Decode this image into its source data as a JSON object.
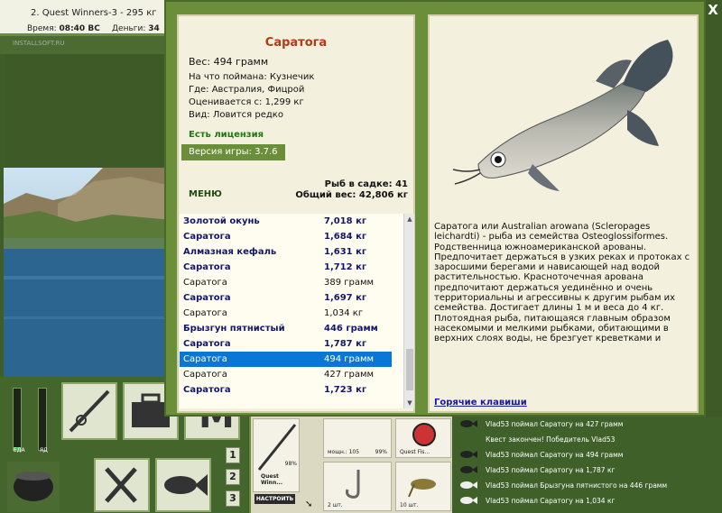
{
  "game_header": {
    "quest_title": "2. Quest Winners-3 - 295 кг",
    "time_label": "Время:",
    "time_value": "08:40 ВС",
    "money_label": "Деньги:",
    "money_value": "34",
    "watermark": "INSTALLSOFT.RU"
  },
  "status_bars": {
    "food_label": "ЕДА",
    "poison_label": "ЯД",
    "food_level": 0.05,
    "poison_level": 0.0
  },
  "tabs": [
    "1",
    "2",
    "3"
  ],
  "tackle": {
    "rod_percent": "98%",
    "rod_name": "Quest Winn...",
    "setup_label": "НАСТРОИТЬ",
    "hook_count": "мощн.: 105",
    "hook_percent": "99%",
    "lure_name": "Quest Fis...",
    "hook_qty": "2 шт.",
    "bait_qty": "10 шт."
  },
  "fish": {
    "name": "Саратога",
    "weight": "Вес: 494 грамм",
    "caught_with": "На что поймана: Кузнечик",
    "location": "Где: Австралия, Фицрой",
    "valued_from": "Оценивается с: 1,299 кг",
    "rarity": "Вид: Ловится редко",
    "license": "Есть лицензия",
    "version": "Версия игры: 3.7.6",
    "menu_label": "МЕНЮ",
    "cage_count": "Рыб в садке: 41",
    "total_weight": "Общий вес: 42,806 кг",
    "description": "Саратога или Australian arowana (Scleropages leichardti) - рыба из семейства Osteoglossiformes. Родственница южноамериканской арованы. Предпочитает держаться в узких реках и протоках с заросшими берегами и нависающей над водой растительностью. Красноточечная арована предпочитают держаться уединённо и очень территориальны и агрессивны к другим рыбам их семейства. Достигает длины 1 м и веса до 4 кг. Плотоядная рыба, питающаяся главным образом насекомыми и мелкими рыбками, обитающими в верхних слоях воды, не брезгует креветками и",
    "hotkeys_label": "Горячие клавиши"
  },
  "catch_list": [
    {
      "name": "Золотой окунь",
      "weight": "7,018 кг",
      "style": "rare"
    },
    {
      "name": "Саратога",
      "weight": "1,684 кг",
      "style": "rare"
    },
    {
      "name": "Алмазная кефаль",
      "weight": "1,631 кг",
      "style": "rare"
    },
    {
      "name": "Саратога",
      "weight": "1,712 кг",
      "style": "rare"
    },
    {
      "name": "Саратога",
      "weight": "389 грамм",
      "style": "norm"
    },
    {
      "name": "Саратога",
      "weight": "1,697 кг",
      "style": "rare"
    },
    {
      "name": "Саратога",
      "weight": "1,034 кг",
      "style": "norm"
    },
    {
      "name": "Брызгун пятнистый",
      "weight": "446 грамм",
      "style": "rare"
    },
    {
      "name": "Саратога",
      "weight": "1,787 кг",
      "style": "rare"
    },
    {
      "name": "Саратога",
      "weight": "494 грамм",
      "style": "sel"
    },
    {
      "name": "Саратога",
      "weight": "427 грамм",
      "style": "norm"
    },
    {
      "name": "Саратога",
      "weight": "1,723 кг",
      "style": "rare"
    }
  ],
  "event_log": [
    {
      "text": "Vlad53 поймал Саратогу на 427 грамм",
      "icon": "fish-icon"
    },
    {
      "text": "Квест закончен! Победитель Vlad53",
      "icon": ""
    },
    {
      "text": "Vlad53 поймал Саратогу на 494 грамм",
      "icon": "fish-icon"
    },
    {
      "text": "Vlad53 поймал Саратогу на 1,787 кг",
      "icon": "fish-icon"
    },
    {
      "text": "Vlad53 поймал Брызгуна пятнистого на 446 грамм",
      "icon": "fish-icon"
    },
    {
      "text": "Vlad53 поймал Саратогу на 1,034 кг",
      "icon": "fish-icon"
    }
  ],
  "close_label": "X"
}
